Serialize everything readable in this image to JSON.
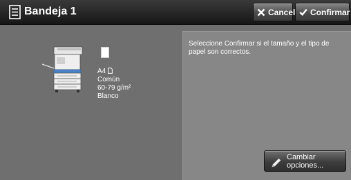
{
  "header": {
    "title": "Bandeja 1",
    "title_icon": "menu-list-icon",
    "cancel_label": "Cancelar",
    "cancel_icon": "x-icon",
    "confirm_label": "Confirmar",
    "confirm_icon": "checkmark-icon"
  },
  "paper": {
    "size": "A4",
    "orientation_icon": "portrait-orientation-icon",
    "type": "Común",
    "weight": "60-79 g/m²",
    "color": "Blanco"
  },
  "message": "Seleccione Confirmar si el tamaño y el tipo de papel son correctos.",
  "change_options": {
    "line1": "Cambiar",
    "line2": "opciones...",
    "icon": "pencil-icon"
  },
  "colors": {
    "background": "#6f6f6f",
    "panel": "#878787",
    "titlebar": "#1e1e1e"
  }
}
